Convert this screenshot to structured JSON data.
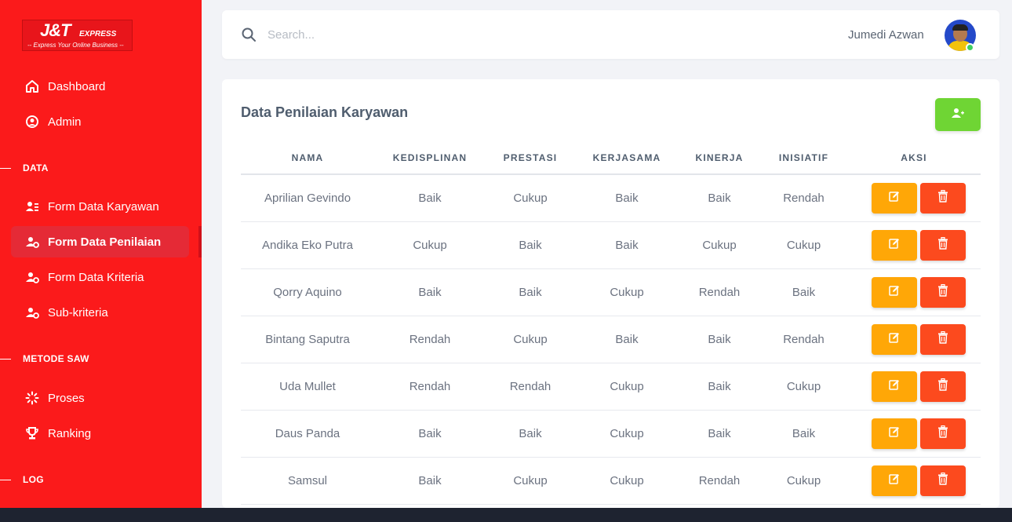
{
  "brand": {
    "logo_main": "J&T",
    "logo_express": "EXPRESS",
    "logo_tagline": "-- Express Your Online Business --"
  },
  "sidebar": {
    "items_top": [
      {
        "label": "Dashboard",
        "icon": "home-icon"
      },
      {
        "label": "Admin",
        "icon": "user-circle-icon"
      }
    ],
    "section_data": "DATA",
    "items_data": [
      {
        "label": "Form Data Karyawan",
        "icon": "user-list-icon"
      },
      {
        "label": "Form Data Penilaian",
        "icon": "user-gear-icon",
        "active": true
      },
      {
        "label": "Form Data Kriteria",
        "icon": "user-gear-icon"
      },
      {
        "label": "Sub-kriteria",
        "icon": "user-gear-icon"
      }
    ],
    "section_saw": "METODE SAW",
    "items_saw": [
      {
        "label": "Proses",
        "icon": "spinner-icon"
      },
      {
        "label": "Ranking",
        "icon": "trophy-icon"
      }
    ],
    "section_log": "LOG"
  },
  "header": {
    "search_placeholder": "Search...",
    "user_name": "Jumedi Azwan"
  },
  "main": {
    "title": "Data Penilaian Karyawan",
    "columns": [
      "NAMA",
      "KEDISPLINAN",
      "PRESTASI",
      "KERJASAMA",
      "KINERJA",
      "INISIATIF",
      "AKSI"
    ],
    "rows": [
      {
        "nama": "Aprilian Gevindo",
        "kedisiplinan": "Baik",
        "prestasi": "Cukup",
        "kerjasama": "Baik",
        "kinerja": "Baik",
        "inisiatif": "Rendah"
      },
      {
        "nama": "Andika Eko Putra",
        "kedisiplinan": "Cukup",
        "prestasi": "Baik",
        "kerjasama": "Baik",
        "kinerja": "Cukup",
        "inisiatif": "Cukup"
      },
      {
        "nama": "Qorry Aquino",
        "kedisiplinan": "Baik",
        "prestasi": "Baik",
        "kerjasama": "Cukup",
        "kinerja": "Rendah",
        "inisiatif": "Baik"
      },
      {
        "nama": "Bintang Saputra",
        "kedisiplinan": "Rendah",
        "prestasi": "Cukup",
        "kerjasama": "Baik",
        "kinerja": "Baik",
        "inisiatif": "Rendah"
      },
      {
        "nama": "Uda Mullet",
        "kedisiplinan": "Rendah",
        "prestasi": "Rendah",
        "kerjasama": "Cukup",
        "kinerja": "Baik",
        "inisiatif": "Cukup"
      },
      {
        "nama": "Daus Panda",
        "kedisiplinan": "Baik",
        "prestasi": "Baik",
        "kerjasama": "Cukup",
        "kinerja": "Baik",
        "inisiatif": "Baik"
      },
      {
        "nama": "Samsul",
        "kedisiplinan": "Baik",
        "prestasi": "Cukup",
        "kerjasama": "Cukup",
        "kinerja": "Rendah",
        "inisiatif": "Cukup"
      }
    ]
  },
  "colors": {
    "sidebar": "#fb1a1b",
    "add_button": "#6fd534",
    "edit_button": "#ffa707",
    "delete_button": "#fc4a1e"
  }
}
